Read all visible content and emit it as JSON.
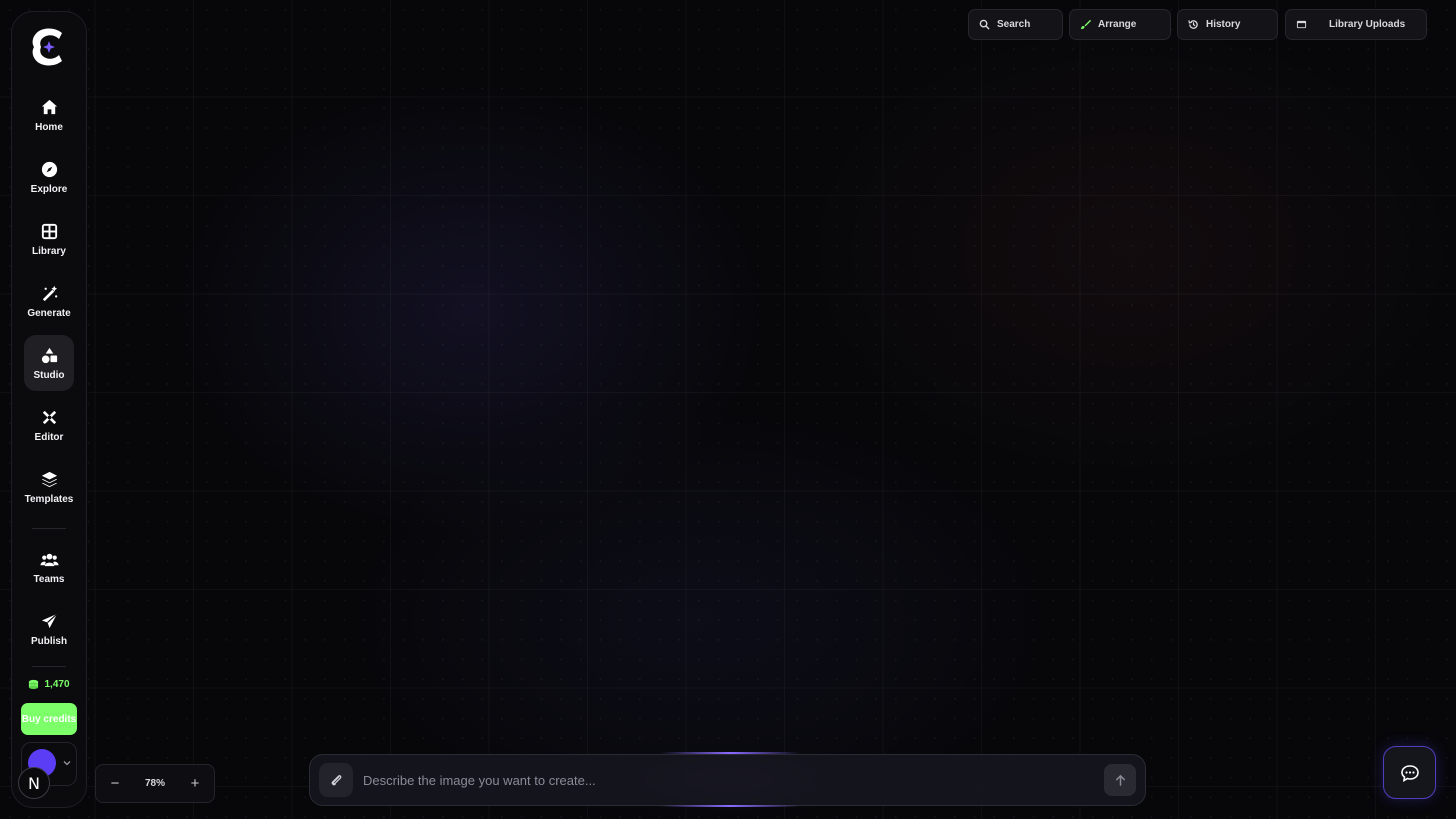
{
  "sidebar": {
    "logo_icon": "brand-logo-icon",
    "items": [
      {
        "label": "Home",
        "icon": "home-icon",
        "active": false
      },
      {
        "label": "Explore",
        "icon": "compass-icon",
        "active": false
      },
      {
        "label": "Library",
        "icon": "grid-icon",
        "active": false
      },
      {
        "label": "Generate",
        "icon": "magic-wand-icon",
        "active": false
      },
      {
        "label": "Studio",
        "icon": "shapes-icon",
        "active": true
      },
      {
        "label": "Editor",
        "icon": "tools-icon",
        "active": false
      },
      {
        "label": "Templates",
        "icon": "layers-icon",
        "active": false
      }
    ],
    "team_items": [
      {
        "label": "Teams",
        "icon": "users-icon"
      },
      {
        "label": "Publish",
        "icon": "send-icon"
      }
    ],
    "credits": "1,470",
    "buy_label": "Buy credits",
    "avatar_letter": "N"
  },
  "toolbar": {
    "search_label": "Search",
    "arrange_label": "Arrange",
    "history_label": "History",
    "uploads_label": "Library Uploads"
  },
  "zoom": {
    "minus": "−",
    "value": "78%",
    "plus": "+"
  },
  "prompt": {
    "placeholder": "Describe the image you want to create..."
  },
  "colors": {
    "accent_green": "#7dff6a",
    "accent_purple": "#5a3df5",
    "background": "#07070a"
  }
}
